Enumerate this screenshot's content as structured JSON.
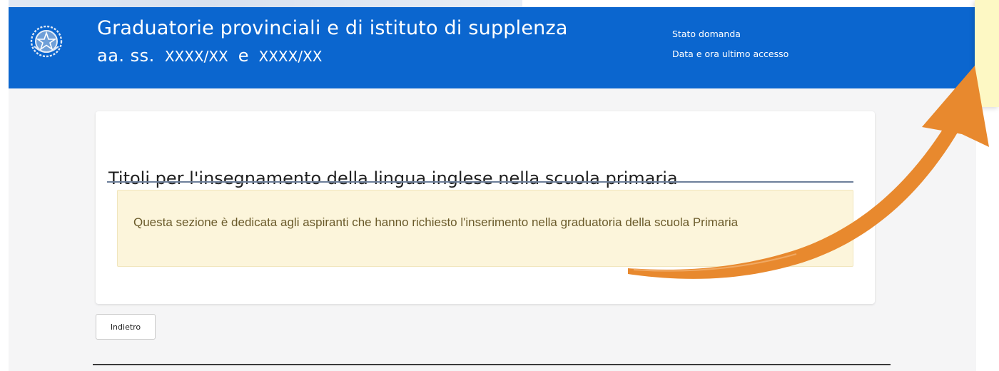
{
  "header": {
    "title": "Graduatorie provinciali e di istituto di supplenza",
    "years_prefix": "aa. ss.",
    "year_from": "XXXX/XX",
    "year_conjunction": "e",
    "year_to": "XXXX/XX",
    "status_label": "Stato domanda",
    "access_label": "Data e ora ultimo accesso"
  },
  "card": {
    "title": "Titoli per l'insegnamento della lingua inglese nella scuola primaria",
    "notice_text": "Questa sezione è dedicata agli aspiranti che hanno richiesto l'inserimento nella graduatoria della scuola Primaria"
  },
  "actions": {
    "back_label": "Indietro"
  },
  "colors": {
    "header_blue": "#0b66cf",
    "notice_bg": "#fcf5db",
    "arrow_orange": "#e8892e"
  },
  "icons": {
    "emblem": "italian-republic-emblem-icon",
    "arrow": "curved-arrow-icon"
  }
}
